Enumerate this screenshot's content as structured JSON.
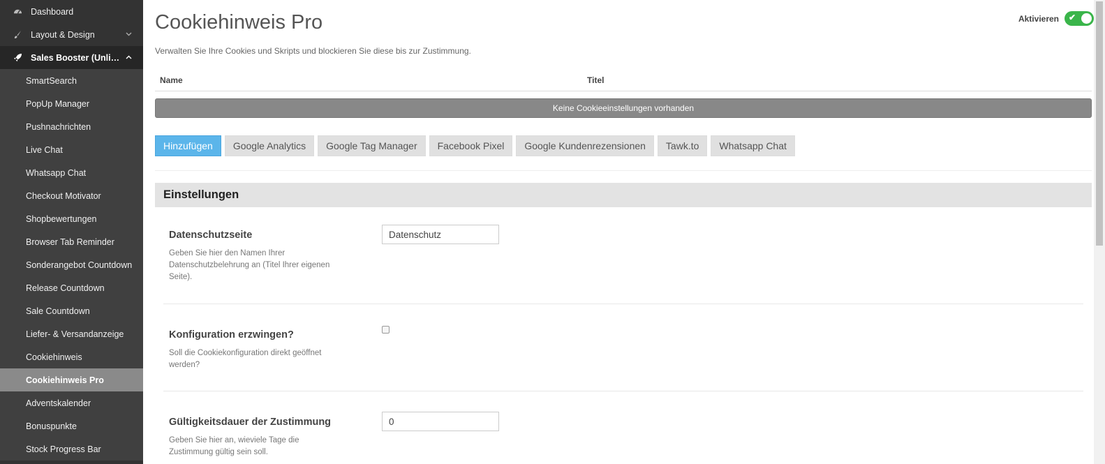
{
  "sidebar": {
    "top_items": [
      {
        "label": "Dashboard",
        "icon": "dashboard-icon"
      },
      {
        "label": "Layout & Design",
        "icon": "brush-icon",
        "chevron": "down"
      },
      {
        "label": "Sales Booster (Unlimitie...",
        "icon": "rocket-icon",
        "chevron": "up"
      }
    ],
    "sub_items": [
      "SmartSearch",
      "PopUp Manager",
      "Pushnachrichten",
      "Live Chat",
      "Whatsapp Chat",
      "Checkout Motivator",
      "Shopbewertungen",
      "Browser Tab Reminder",
      "Sonderangebot Countdown",
      "Release Countdown",
      "Sale Countdown",
      "Liefer- & Versandanzeige",
      "Cookiehinweis",
      "Cookiehinweis Pro",
      "Adventskalender",
      "Bonuspunkte",
      "Stock Progress Bar"
    ],
    "active_item": "Cookiehinweis Pro"
  },
  "header": {
    "title": "Cookiehinweis Pro",
    "subtitle": "Verwalten Sie Ihre Cookies und Skripts und blockieren Sie diese bis zur Zustimmung.",
    "toggle_label": "Aktivieren",
    "toggle_on": true
  },
  "table": {
    "columns": [
      "Name",
      "Titel"
    ],
    "empty_text": "Keine Cookieeinstellungen vorhanden"
  },
  "buttons": [
    "Hinzufügen",
    "Google Analytics",
    "Google Tag Manager",
    "Facebook Pixel",
    "Google Kundenrezensionen",
    "Tawk.to",
    "Whatsapp Chat"
  ],
  "settings": {
    "heading": "Einstellungen",
    "privacy_page": {
      "title": "Datenschutzseite",
      "description": "Geben Sie hier den Namen Ihrer Datenschutzbelehrung an (Titel Ihrer eigenen Seite).",
      "value": "Datenschutz"
    },
    "force_config": {
      "title": "Konfiguration erzwingen?",
      "description": "Soll die Cookiekonfiguration direkt geöffnet werden?",
      "checked": false
    },
    "validity": {
      "title": "Gültigkeitsdauer der Zustimmung",
      "description": "Geben Sie hier an, wieviele Tage die Zustimmung gültig sein soll.",
      "value": "0"
    }
  },
  "colors": {
    "sidebar_bg": "#333333",
    "sidebar_active": "#8a8a8a",
    "primary_button": "#5bb5ea",
    "toggle_on": "#3ab54a"
  }
}
